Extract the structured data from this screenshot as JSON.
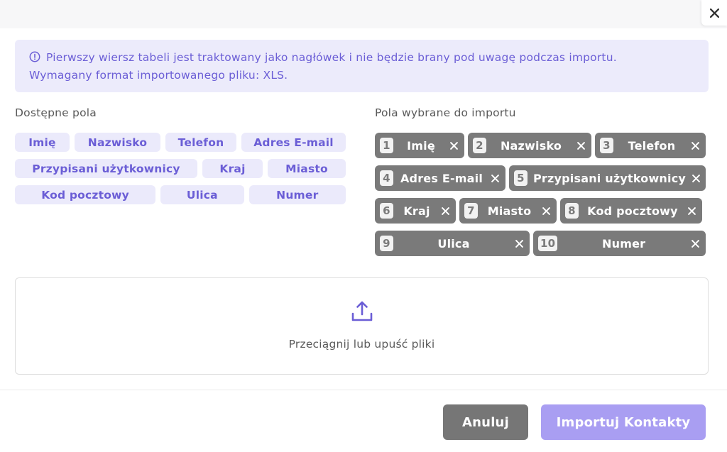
{
  "notice": {
    "line1": "Pierwszy wiersz tabeli jest traktowany jako nagłówek i nie będzie brany pod uwagę podczas importu.",
    "line2": "Wymagany format importowanego pliku: XLS.",
    "icon": "info-circle-icon"
  },
  "available": {
    "label": "Dostępne pola",
    "rows": [
      [
        "Imię",
        "Nazwisko",
        "Telefon",
        "Adres E-mail"
      ],
      [
        "Przypisani użytkownicy",
        "Kraj",
        "Miasto"
      ],
      [
        "Kod pocztowy",
        "Ulica",
        "Numer"
      ]
    ]
  },
  "selected": {
    "label": "Pola wybrane do importu",
    "items": [
      {
        "num": "1",
        "name": "Imię"
      },
      {
        "num": "2",
        "name": "Nazwisko"
      },
      {
        "num": "3",
        "name": "Telefon"
      },
      {
        "num": "4",
        "name": "Adres E-mail"
      },
      {
        "num": "5",
        "name": "Przypisani użytkownicy"
      },
      {
        "num": "6",
        "name": "Kraj"
      },
      {
        "num": "7",
        "name": "Miasto"
      },
      {
        "num": "8",
        "name": "Kod pocztowy"
      },
      {
        "num": "9",
        "name": "Ulica"
      },
      {
        "num": "10",
        "name": "Numer"
      }
    ]
  },
  "dropzone": {
    "text": "Przeciągnij lub upuść pliki",
    "icon": "upload-icon"
  },
  "footer": {
    "cancel_label": "Anuluj",
    "import_label": "Importuj Kontakty"
  },
  "colors": {
    "accent": "#6b5ed6",
    "chip_bg": "#ebeafb",
    "selected_chip": "#7a7a7a",
    "import_button": "#a99ef2",
    "cancel_button": "#767676"
  }
}
